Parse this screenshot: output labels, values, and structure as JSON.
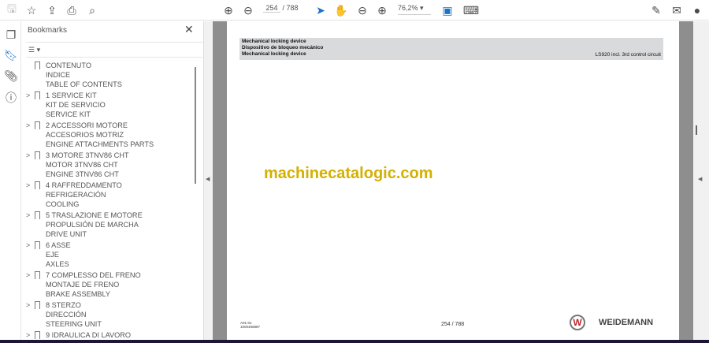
{
  "toolbar": {
    "page_current": "254",
    "page_total": "/ 788",
    "zoom": "76,2%"
  },
  "panel": {
    "title": "Bookmarks",
    "close": "✕",
    "options": "☰ ▾"
  },
  "bookmarks": [
    {
      "lines": [
        "CONTENUTO",
        "INDICE",
        "TABLE OF CONTENTS"
      ],
      "expandable": false
    },
    {
      "lines": [
        "1 SERVICE KIT",
        "KIT DE SERVICIO",
        "SERVICE KIT"
      ],
      "expandable": true
    },
    {
      "lines": [
        "2 ACCESSORI MOTORE",
        "ACCESORIOS MOTRIZ",
        "ENGINE ATTACHMENTS PARTS"
      ],
      "expandable": true
    },
    {
      "lines": [
        "3 MOTORE 3TNV86 CHT",
        "MOTOR 3TNV86 CHT",
        "ENGINE 3TNV86 CHT"
      ],
      "expandable": true
    },
    {
      "lines": [
        "4 RAFFREDDAMENTO",
        "REFRIGERACIÓN",
        "COOLING"
      ],
      "expandable": true
    },
    {
      "lines": [
        "5 TRASLAZIONE E MOTORE",
        "PROPULSIÓN DE MARCHA",
        "DRIVE UNIT"
      ],
      "expandable": true
    },
    {
      "lines": [
        "6 ASSE",
        "EJE",
        "AXLES"
      ],
      "expandable": true
    },
    {
      "lines": [
        "7 COMPLESSO DEL FRENO",
        "MONTAJE DE FRENO",
        "BRAKE ASSEMBLY"
      ],
      "expandable": true
    },
    {
      "lines": [
        "8 STERZO",
        "DIRECCIÓN",
        "STEERING UNIT"
      ],
      "expandable": true
    },
    {
      "lines": [
        "9 IDRAULICA DI LAVORO",
        "",
        ""
      ],
      "expandable": true
    }
  ],
  "document": {
    "header_lines": [
      "Mechanical locking device",
      "Dispositivo de bloqueo mecánico",
      "Mechanical locking device"
    ],
    "header_right": "LS920 incl. 3rd control circuit",
    "watermark": "machinecatalogic.com",
    "footer_code1": "A01-01",
    "footer_code2": "1000456887",
    "footer_page": "254 / 788",
    "brand": "WEIDEMANN",
    "logo_letter": "W"
  }
}
